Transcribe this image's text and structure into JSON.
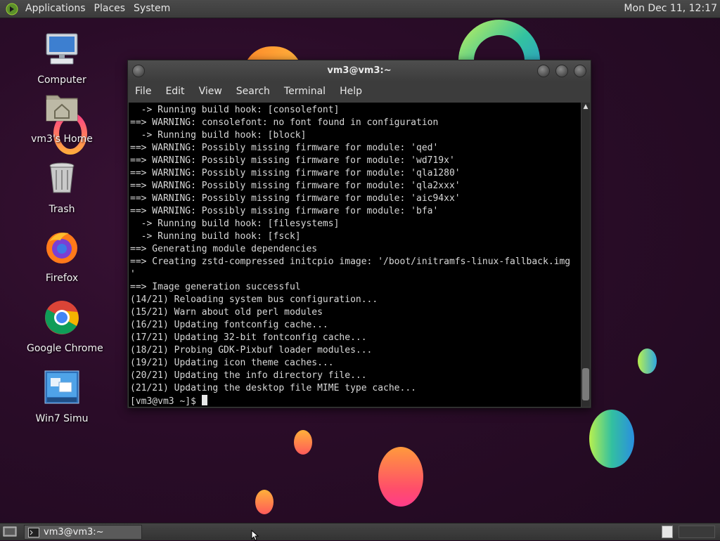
{
  "top_panel": {
    "menus": [
      "Applications",
      "Places",
      "System"
    ],
    "clock": "Mon Dec 11, 12:17"
  },
  "desktop_icons": [
    {
      "label": "Computer",
      "icon": "computer-icon"
    },
    {
      "label": "vm3's Home",
      "icon": "home-folder-icon"
    },
    {
      "label": "Trash",
      "icon": "trash-icon"
    },
    {
      "label": "Firefox",
      "icon": "firefox-icon"
    },
    {
      "label": "Google Chrome",
      "icon": "chrome-icon"
    },
    {
      "label": "Win7 Simu",
      "icon": "win7-icon"
    }
  ],
  "terminal": {
    "title": "vm3@vm3:~",
    "menu": [
      "File",
      "Edit",
      "View",
      "Search",
      "Terminal",
      "Help"
    ],
    "lines": [
      "  -> Running build hook: [consolefont]",
      "==> WARNING: consolefont: no font found in configuration",
      "  -> Running build hook: [block]",
      "==> WARNING: Possibly missing firmware for module: 'qed'",
      "==> WARNING: Possibly missing firmware for module: 'wd719x'",
      "==> WARNING: Possibly missing firmware for module: 'qla1280'",
      "==> WARNING: Possibly missing firmware for module: 'qla2xxx'",
      "==> WARNING: Possibly missing firmware for module: 'aic94xx'",
      "==> WARNING: Possibly missing firmware for module: 'bfa'",
      "  -> Running build hook: [filesystems]",
      "  -> Running build hook: [fsck]",
      "==> Generating module dependencies",
      "==> Creating zstd-compressed initcpio image: '/boot/initramfs-linux-fallback.img",
      "'",
      "==> Image generation successful",
      "(14/21) Reloading system bus configuration...",
      "(15/21) Warn about old perl modules",
      "(16/21) Updating fontconfig cache...",
      "(17/21) Updating 32-bit fontconfig cache...",
      "(18/21) Probing GDK-Pixbuf loader modules...",
      "(19/21) Updating icon theme caches...",
      "(20/21) Updating the info directory file...",
      "(21/21) Updating the desktop file MIME type cache..."
    ],
    "prompt": "[vm3@vm3 ~]$ "
  },
  "bottom_panel": {
    "task_label": "vm3@vm3:~"
  },
  "colors": {
    "wallpaper": "#2a0c28",
    "panel": "#3b3b3b",
    "terminal_bg": "#000000",
    "terminal_fg": "#d8d8d8"
  }
}
